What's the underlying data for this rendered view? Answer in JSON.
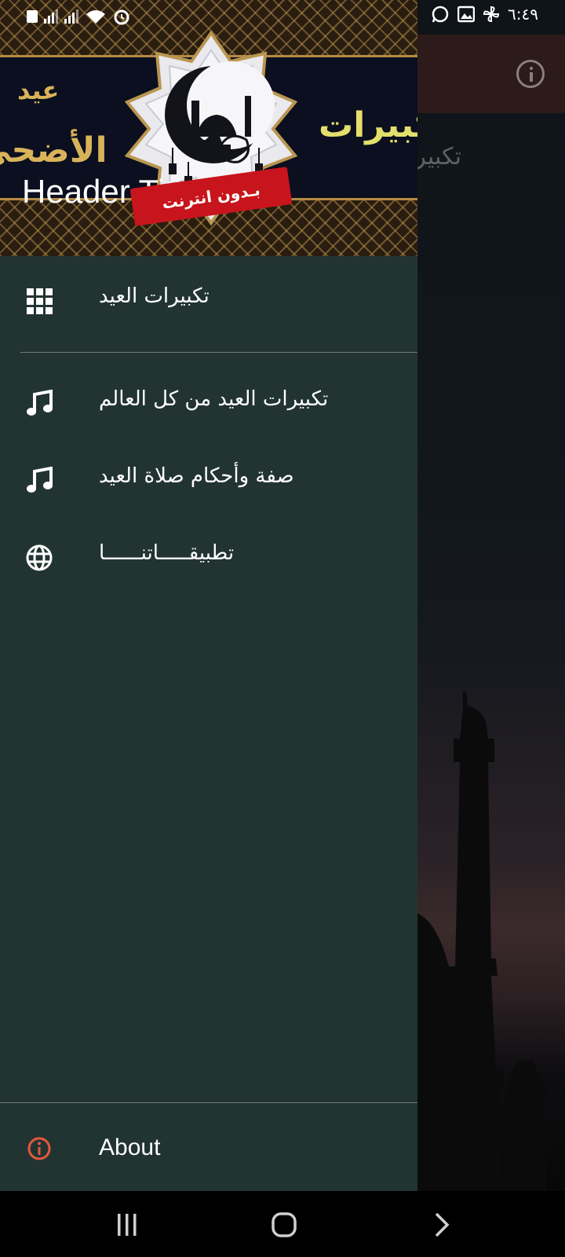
{
  "status_bar": {
    "time": "٦:٤٩",
    "left_icons": [
      "notification-icon",
      "signal-icon",
      "signal-icon",
      "wifi-icon",
      "alarm-icon"
    ],
    "right_icons": [
      "whatsapp-icon",
      "gallery-icon",
      "pinwheel-icon"
    ]
  },
  "app": {
    "partial_text": "تكبيرات",
    "info_icon": "info-icon"
  },
  "drawer": {
    "header": {
      "title": "Header Title",
      "banner_words": {
        "eid": "عيد",
        "adha": "الأضحى",
        "takbirat": "تكبيرات"
      },
      "ribbon_text": "بـدون انترنت"
    },
    "menu": [
      {
        "label": "تكبيرات العيد",
        "icon": "grid-icon"
      },
      {
        "label": "تكبيرات العيد من كل العالم",
        "icon": "music-note-icon"
      },
      {
        "label": "صفة وأحكام صلاة العيد",
        "icon": "music-note-icon"
      },
      {
        "label": "تطبيقـــــاتنــــــا",
        "icon": "globe-icon"
      }
    ],
    "about": {
      "label": "About",
      "icon": "info-icon",
      "accent": "#e2583e"
    }
  },
  "colors": {
    "drawer_bg": "#223431",
    "header_gold": "#d9b35a",
    "ribbon_red": "#c8141c"
  },
  "nav_bar": {
    "buttons": [
      "recent-apps",
      "home",
      "back"
    ]
  }
}
